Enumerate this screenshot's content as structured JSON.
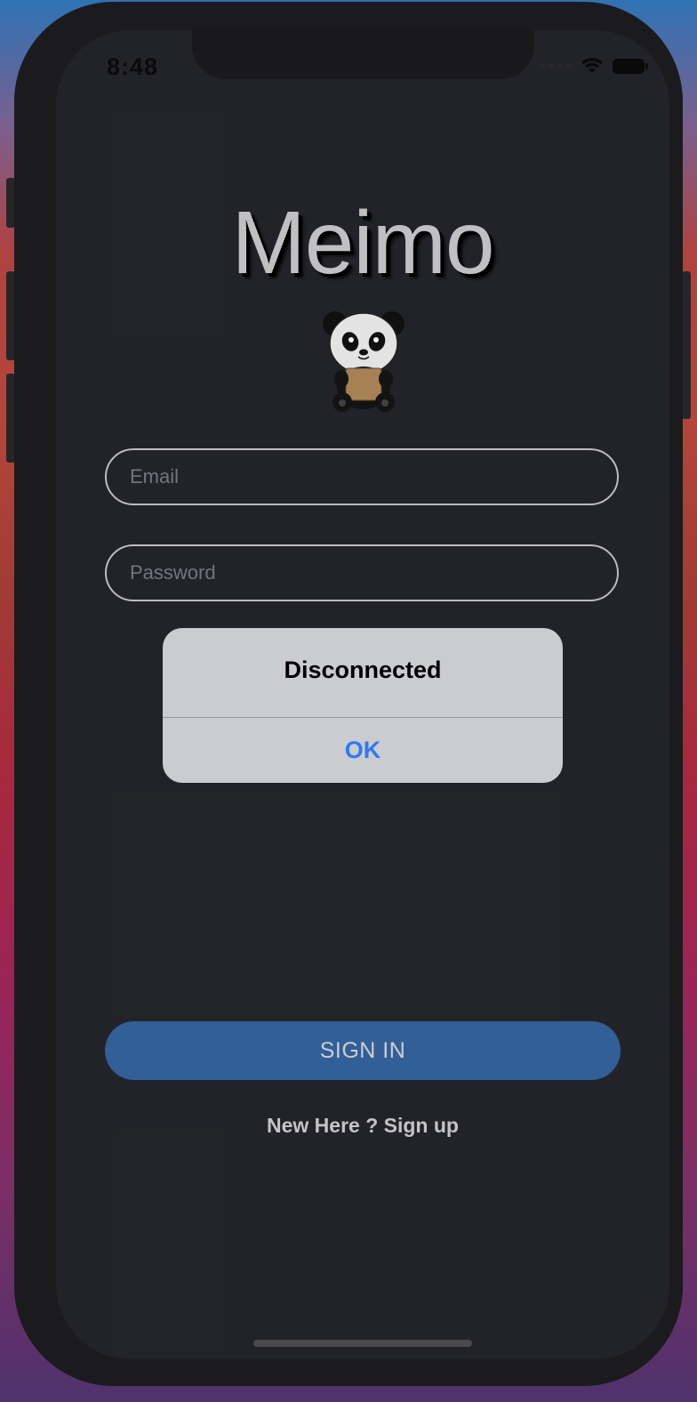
{
  "status_bar": {
    "time": "8:48"
  },
  "app": {
    "title": "Meimo",
    "mascot_icon": "panda-mascot-icon"
  },
  "form": {
    "email_placeholder": "Email",
    "password_placeholder": "Password",
    "signin_label": "SIGN IN",
    "signup_link": "New Here ? Sign up"
  },
  "alert": {
    "title": "Disconnected",
    "ok_label": "OK"
  },
  "colors": {
    "screen_bg": "#25262b",
    "accent": "#3565a0",
    "alert_bg": "#cbcccf",
    "alert_button": "#2f7bf0"
  }
}
